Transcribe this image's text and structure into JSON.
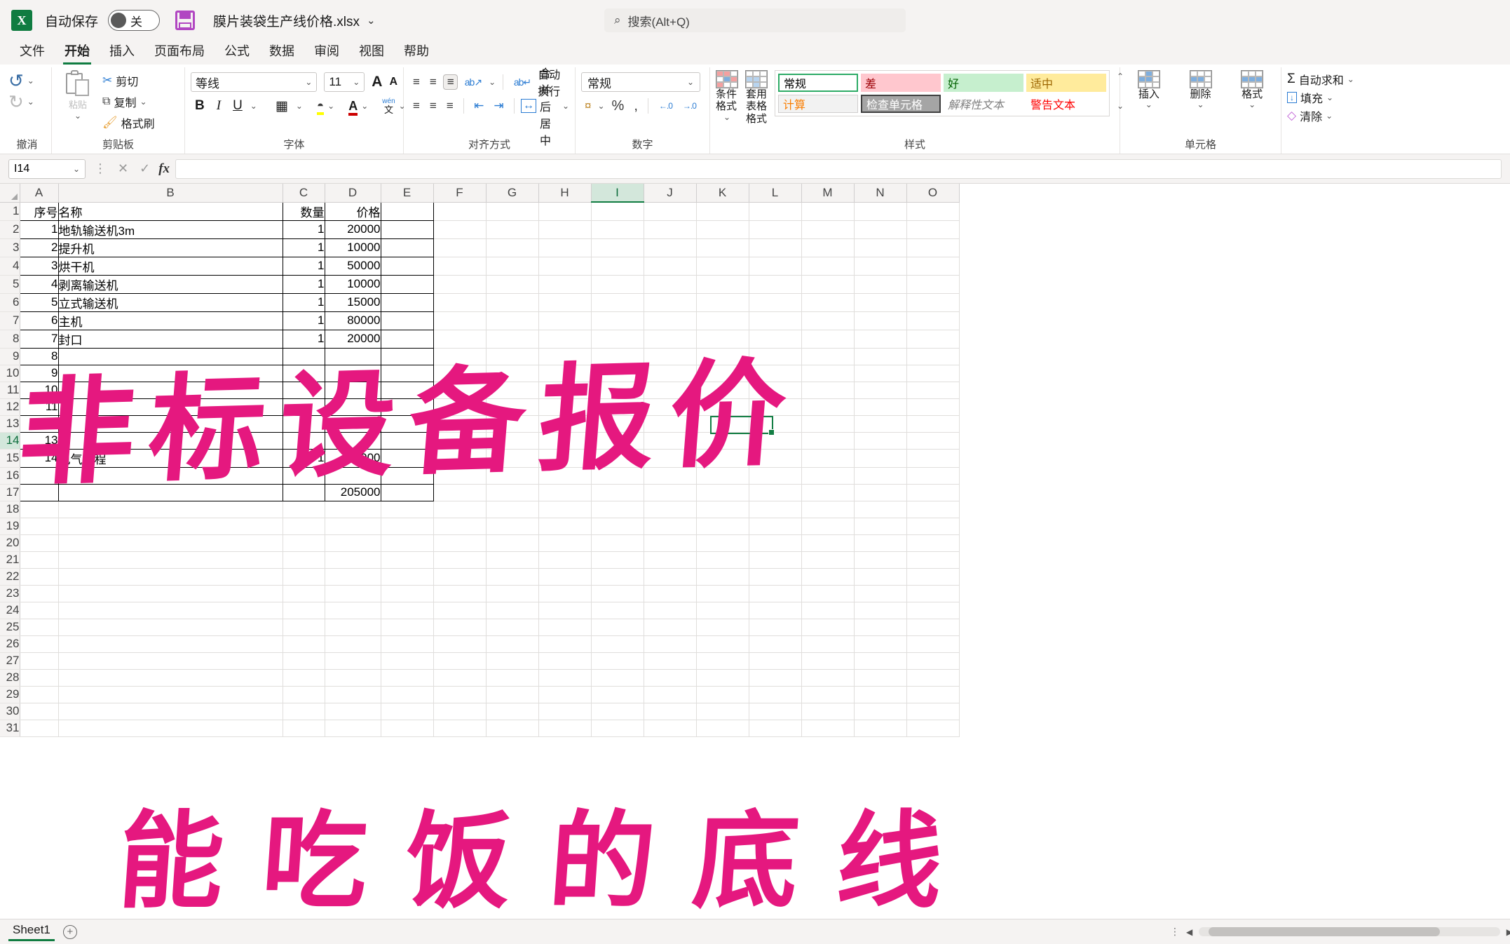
{
  "titlebar": {
    "logo_text": "X",
    "autosave_label": "自动保存",
    "autosave_state": "关",
    "filename": "膜片装袋生产线价格.xlsx",
    "chevron": "⌄",
    "search_placeholder": "搜索(Alt+Q)",
    "search_icon": "⌕"
  },
  "tabs": [
    {
      "label": "文件",
      "active": false
    },
    {
      "label": "开始",
      "active": true
    },
    {
      "label": "插入",
      "active": false
    },
    {
      "label": "页面布局",
      "active": false
    },
    {
      "label": "公式",
      "active": false
    },
    {
      "label": "数据",
      "active": false
    },
    {
      "label": "审阅",
      "active": false
    },
    {
      "label": "视图",
      "active": false
    },
    {
      "label": "帮助",
      "active": false
    }
  ],
  "ribbon": {
    "undo_group": {
      "name": "撤消",
      "undo_icon": "↺",
      "redo_icon": "↻"
    },
    "clipboard": {
      "name": "剪贴板",
      "paste_label": "粘贴",
      "cut_label": "剪切",
      "copy_label": "复制",
      "format_painter_label": "格式刷"
    },
    "font": {
      "name": "字体",
      "font_family": "等线",
      "font_size": "11",
      "grow_label": "A",
      "shrink_label": "A",
      "bold": "B",
      "italic": "I",
      "underline": "U",
      "border_icon": "▦",
      "fill_icon": "◓",
      "color_icon": "A",
      "pinyin_top": "wén",
      "pinyin_bottom": "文"
    },
    "alignment": {
      "name": "对齐方式",
      "top_icon": "≡",
      "middle_icon": "≡",
      "bottom_icon": "≡",
      "orient_icon": "ab↗",
      "left_icon": "≡",
      "center_icon": "≡",
      "right_icon": "≡",
      "indent_dec": "⇤",
      "indent_inc": "⇥",
      "wrap_label": "自动换行",
      "wrap_icon": "ab↵",
      "merge_label": "合并后居中",
      "merge_icon": "↔"
    },
    "number": {
      "name": "数字",
      "format": "常规",
      "currency_icon": "¤",
      "percent_icon": "%",
      "comma_icon": ",",
      "dec_inc_icon": "←.0",
      "dec_dec_icon": "→.0"
    },
    "styles": {
      "name": "样式",
      "cond_format_label": "条件格式",
      "table_format_label": "套用\n表格格式",
      "cells": [
        {
          "label": "常规",
          "bg": "#ffffff",
          "fg": "#000000",
          "border": "#2dab66"
        },
        {
          "label": "差",
          "bg": "#ffc7ce",
          "fg": "#9c0006",
          "border": ""
        },
        {
          "label": "好",
          "bg": "#c6efce",
          "fg": "#006100",
          "border": ""
        },
        {
          "label": "适中",
          "bg": "#ffeb9c",
          "fg": "#9c6500",
          "border": ""
        },
        {
          "label": "计算",
          "bg": "#f2f2f2",
          "fg": "#fa7d00",
          "border": ""
        },
        {
          "label": "检查单元格",
          "bg": "#a5a5a5",
          "fg": "#ffffff",
          "border": "#3f3f3f"
        },
        {
          "label": "解释性文本",
          "bg": "#ffffff",
          "fg": "#7f7f7f",
          "border": ""
        },
        {
          "label": "警告文本",
          "bg": "#ffffff",
          "fg": "#ff0000",
          "border": ""
        }
      ]
    },
    "cells_group": {
      "name": "单元格",
      "insert_label": "插入",
      "delete_label": "删除",
      "format_label": "格式"
    },
    "editing": {
      "autosum_label": "自动求和",
      "autosum_icon": "Σ",
      "fill_label": "填充",
      "fill_icon": "↓",
      "clear_label": "清除",
      "clear_icon": "◇"
    }
  },
  "formula_bar": {
    "name_box": "I14",
    "cancel_icon": "✕",
    "confirm_icon": "✓",
    "fx_icon": "fx",
    "formula_value": ""
  },
  "grid": {
    "columns": [
      "A",
      "B",
      "C",
      "D",
      "E",
      "F",
      "G",
      "H",
      "I",
      "J",
      "K",
      "L",
      "M",
      "N",
      "O"
    ],
    "selected_column": "I",
    "selected_row": 14,
    "selected_cell": "I14",
    "row_count": 31,
    "headers": {
      "a": "序号",
      "b": "名称",
      "c": "数量",
      "d": "价格"
    },
    "rows": [
      {
        "row": 1,
        "a": "序号",
        "b": "名称",
        "c": "数量",
        "d": "价格"
      },
      {
        "row": 2,
        "a": "1",
        "b": "地轨输送机3m",
        "c": "1",
        "d": "20000"
      },
      {
        "row": 3,
        "a": "2",
        "b": "提升机",
        "c": "1",
        "d": "10000"
      },
      {
        "row": 4,
        "a": "3",
        "b": "烘干机",
        "c": "1",
        "d": "50000"
      },
      {
        "row": 5,
        "a": "4",
        "b": "剥离输送机",
        "c": "1",
        "d": "10000"
      },
      {
        "row": 6,
        "a": "5",
        "b": "立式输送机",
        "c": "1",
        "d": "15000"
      },
      {
        "row": 7,
        "a": "6",
        "b": "主机",
        "c": "1",
        "d": "80000"
      },
      {
        "row": 8,
        "a": "7",
        "b": "封口",
        "c": "1",
        "d": "20000"
      },
      {
        "row": 9,
        "a": "8",
        "b": "",
        "c": "",
        "d": ""
      },
      {
        "row": 10,
        "a": "9",
        "b": "",
        "c": "",
        "d": ""
      },
      {
        "row": 11,
        "a": "10",
        "b": "",
        "c": "",
        "d": ""
      },
      {
        "row": 12,
        "a": "11",
        "b": "",
        "c": "",
        "d": ""
      },
      {
        "row": 13,
        "a": "12",
        "b": "",
        "c": "",
        "d": ""
      },
      {
        "row": 14,
        "a": "13",
        "b": "",
        "c": "",
        "d": ""
      },
      {
        "row": 15,
        "a": "14",
        "b": "电气编程",
        "c": "1",
        "d": "20000"
      },
      {
        "row": 16,
        "a": "",
        "b": "",
        "c": "",
        "d": ""
      },
      {
        "row": 17,
        "a": "",
        "b": "",
        "c": "",
        "d": "205000"
      }
    ]
  },
  "watermarks": {
    "line1": "非标设备报价",
    "line2": "能吃饭的底线",
    "color": "#e5187f"
  },
  "statusbar": {
    "sheet_name": "Sheet1",
    "add_sheet_icon": "+",
    "menu_dots": "⋮",
    "scroll_left_icon": "◀",
    "scroll_right_icon": "▶"
  }
}
